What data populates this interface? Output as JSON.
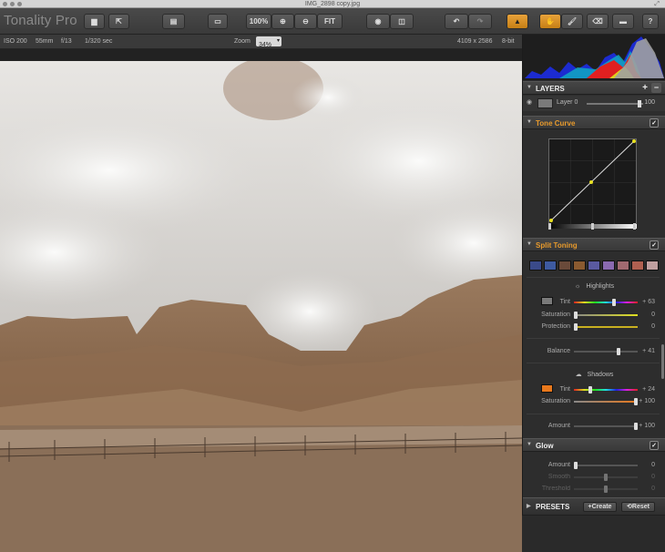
{
  "window": {
    "title": "IMG_2898 copy.jpg"
  },
  "app": {
    "name": "Tonality Pro"
  },
  "toolbar": {
    "zoom_100": "100%",
    "fit": "FIT",
    "help": "?"
  },
  "info": {
    "iso": "ISO 200",
    "focal": "55mm",
    "aperture": "f/13",
    "shutter": "1/320 sec",
    "zoom_label": "Zoom",
    "zoom_value": "34%",
    "dimensions": "4109 x 2586",
    "depth": "8-bit"
  },
  "layers": {
    "title": "LAYERS",
    "add": "+",
    "remove": "−",
    "layer_name": "Layer 0",
    "opacity": "100"
  },
  "tone_curve": {
    "title": "Tone Curve",
    "enabled": "✓"
  },
  "split_toning": {
    "title": "Split Toning",
    "enabled": "✓",
    "swatches": [
      "#3a4a8a",
      "#3e5aa0",
      "#6a4a3a",
      "#8a5a30",
      "#5a5aa0",
      "#8a6ab0",
      "#a06a70",
      "#b06050",
      "#c0a0a0"
    ],
    "highlights": {
      "title": "Highlights",
      "tint_label": "Tint",
      "tint_value": "+ 63",
      "tint": 0.63,
      "saturation_label": "Saturation",
      "saturation_value": "0",
      "saturation": 0.0,
      "protection_label": "Protection",
      "protection_value": "0",
      "protection": 0.0,
      "swatch_color": "#7a7a7a"
    },
    "balance": {
      "label": "Balance",
      "value": "+ 41",
      "fraction": 0.705
    },
    "shadows": {
      "title": "Shadows",
      "tint_label": "Tint",
      "tint_value": "+ 24",
      "tint": 0.24,
      "saturation_label": "Saturation",
      "saturation_value": "+ 100",
      "saturation": 1.0,
      "swatch_color": "#e8781c"
    },
    "amount": {
      "label": "Amount",
      "value": "+ 100",
      "fraction": 1.0
    }
  },
  "glow": {
    "title": "Glow",
    "enabled": "✓",
    "amount_label": "Amount",
    "amount_value": "0",
    "smooth_label": "Smooth",
    "smooth_value": "0",
    "threshold_label": "Threshold",
    "threshold_value": "0"
  },
  "presets": {
    "title": "PRESETS",
    "create": "Create",
    "reset": "Reset"
  },
  "colors": {
    "accent": "#e89a2c",
    "panel_bg": "#2d2d2d"
  }
}
